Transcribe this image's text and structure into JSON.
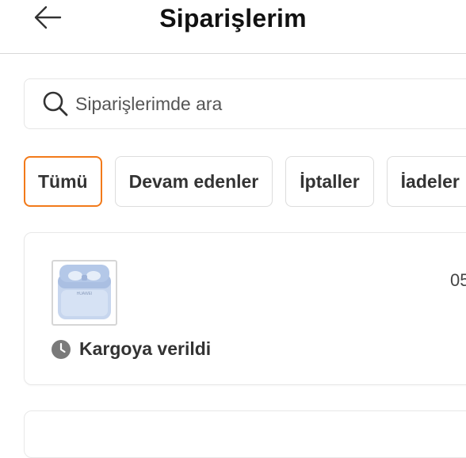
{
  "header": {
    "title": "Siparişlerim",
    "back_icon": "arrow-left-icon"
  },
  "search": {
    "placeholder": "Siparişlerimde ara",
    "value": "",
    "icon": "search-icon"
  },
  "filters": {
    "active_color": "#f27a1a",
    "items": [
      {
        "label": "Tümü",
        "active": true
      },
      {
        "label": "Devam edenler",
        "active": false
      },
      {
        "label": "İptaller",
        "active": false
      },
      {
        "label": "İadeler",
        "active": false
      }
    ]
  },
  "orders": [
    {
      "date": "05",
      "status": "Kargoya verildi",
      "status_icon": "clock-icon",
      "thumbnail_brand": "HUAWEI"
    }
  ]
}
